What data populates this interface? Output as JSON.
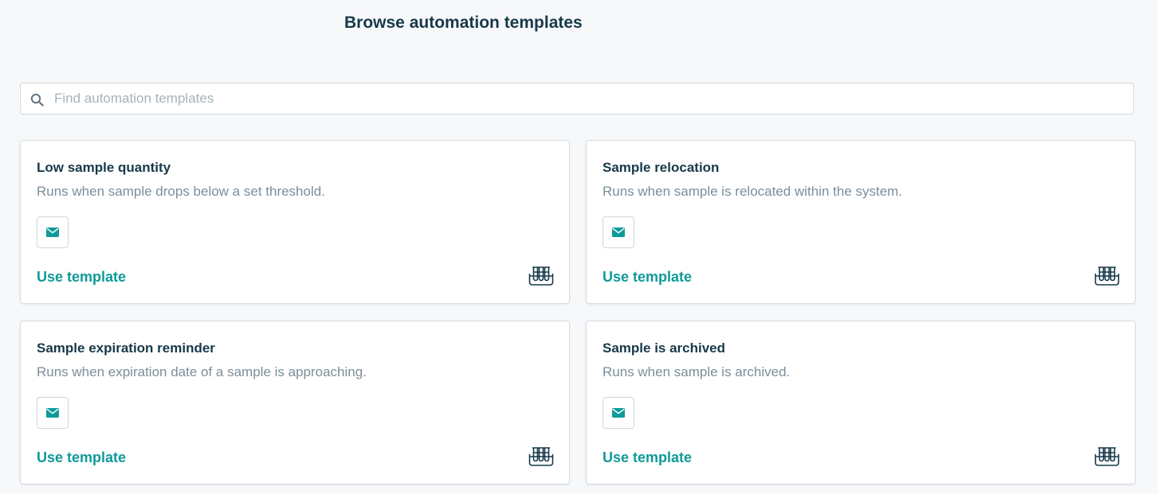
{
  "header": {
    "title": "Browse automation templates"
  },
  "search": {
    "placeholder": "Find automation templates",
    "value": "",
    "icon": "search-icon"
  },
  "colors": {
    "accent": "#0f9a9a",
    "heading": "#17394a",
    "muted": "#7c8e99",
    "background": "#f7f8fa"
  },
  "templates": [
    {
      "title": "Low sample quantity",
      "description": "Runs when sample drops below a set threshold.",
      "action_icon": "envelope-icon",
      "link_label": "Use template",
      "category_icon": "test-tube-rack-icon"
    },
    {
      "title": "Sample relocation",
      "description": "Runs when sample is relocated within the system.",
      "action_icon": "envelope-icon",
      "link_label": "Use template",
      "category_icon": "test-tube-rack-icon"
    },
    {
      "title": "Sample expiration reminder",
      "description": "Runs when expiration date of a sample is approaching.",
      "action_icon": "envelope-icon",
      "link_label": "Use template",
      "category_icon": "test-tube-rack-icon"
    },
    {
      "title": "Sample is archived",
      "description": "Runs when sample is archived.",
      "action_icon": "envelope-icon",
      "link_label": "Use template",
      "category_icon": "test-tube-rack-icon"
    }
  ]
}
